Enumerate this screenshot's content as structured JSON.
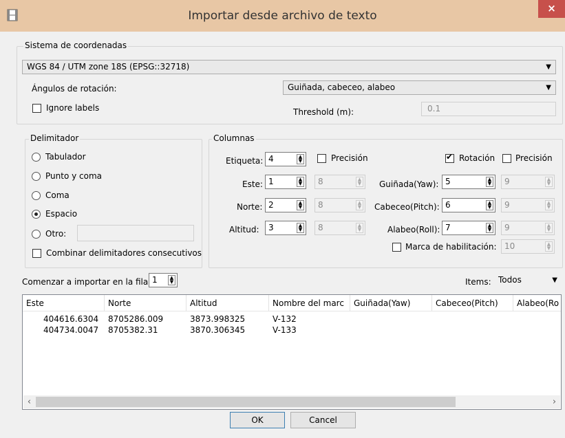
{
  "window": {
    "title": "Importar desde archivo de texto",
    "close_label": "×"
  },
  "crs": {
    "group_label": "Sistema de coordenadas",
    "selected": "WGS 84 / UTM zone 18S (EPSG::32718)",
    "rotation_label": "Ángulos de rotación:",
    "rotation_selected": "Guiñada, cabeceo, alabeo",
    "ignore_labels": "Ignore labels",
    "threshold_label": "Threshold (m):",
    "threshold_value": "0.1"
  },
  "delimiter": {
    "group_label": "Delimitador",
    "options": [
      "Tabulador",
      "Punto y coma",
      "Coma",
      "Espacio",
      "Otro:"
    ],
    "selected": "Espacio",
    "merge_label": "Combinar delimitadores consecutivos"
  },
  "columns": {
    "group_label": "Columnas",
    "etiqueta_label": "Etiqueta:",
    "etiqueta_value": "4",
    "precision_label": "Precisión",
    "este_label": "Este:",
    "este_value": "1",
    "este_prec": "8",
    "norte_label": "Norte:",
    "norte_value": "2",
    "norte_prec": "8",
    "altitud_label": "Altitud:",
    "altitud_value": "3",
    "altitud_prec": "8",
    "rotacion_label": "Rotación",
    "precision2_label": "Precisión",
    "yaw_label": "Guiñada(Yaw):",
    "yaw_value": "5",
    "yaw_prec": "9",
    "pitch_label": "Cabeceo(Pitch):",
    "pitch_value": "6",
    "pitch_prec": "9",
    "roll_label": "Alabeo(Roll):",
    "roll_value": "7",
    "roll_prec": "9",
    "marca_label": "Marca de habilitación:",
    "marca_value": "10"
  },
  "import": {
    "start_row_label": "Comenzar a importar en la fila:",
    "start_row_value": "1",
    "items_label": "Items:",
    "items_selected": "Todos"
  },
  "table": {
    "headers": [
      "Este",
      "Norte",
      "Altitud",
      "Nombre del marc",
      "Guiñada(Yaw)",
      "Cabeceo(Pitch)",
      "Alabeo(Ro"
    ],
    "rows": [
      [
        "404616.6304",
        "8705286.009",
        "3873.998325",
        "V-132"
      ],
      [
        "404734.0047",
        "8705382.31",
        "3870.306345",
        "V-133"
      ]
    ]
  },
  "buttons": {
    "ok": "OK",
    "cancel": "Cancel"
  }
}
